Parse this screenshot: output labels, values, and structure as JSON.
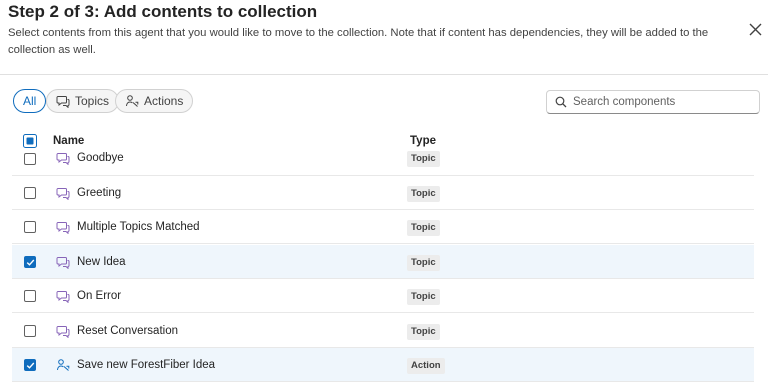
{
  "dialog": {
    "title": "Step 2 of 3: Add contents to collection",
    "subtitle": "Select contents from this agent that you would like to move to the collection. Note that if content has dependencies, they will be added to the collection as well."
  },
  "filters": [
    {
      "label": "All",
      "active": true
    },
    {
      "label": "Topics",
      "icon": "topic-icon"
    },
    {
      "label": "Actions",
      "icon": "action-icon"
    }
  ],
  "search": {
    "placeholder": "Search components",
    "value": ""
  },
  "table": {
    "columns": {
      "name": "Name",
      "type": "Type"
    },
    "header_checkbox": "partial",
    "rows": [
      {
        "name": "Goodbye",
        "type": "Topic",
        "icon": "topic-icon",
        "checked": false
      },
      {
        "name": "Greeting",
        "type": "Topic",
        "icon": "topic-icon",
        "checked": false
      },
      {
        "name": "Multiple Topics Matched",
        "type": "Topic",
        "icon": "topic-icon",
        "checked": false
      },
      {
        "name": "New Idea",
        "type": "Topic",
        "icon": "topic-icon",
        "checked": true
      },
      {
        "name": "On Error",
        "type": "Topic",
        "icon": "topic-icon",
        "checked": false
      },
      {
        "name": "Reset Conversation",
        "type": "Topic",
        "icon": "topic-icon",
        "checked": false
      },
      {
        "name": "Save new ForestFiber Idea",
        "type": "Action",
        "icon": "action-icon",
        "checked": true
      }
    ]
  },
  "colors": {
    "accent": "#0f6cbd",
    "selected_row": "#eff6fc",
    "topic_icon": "#8764b8",
    "action_icon": "#0f6cbd"
  }
}
